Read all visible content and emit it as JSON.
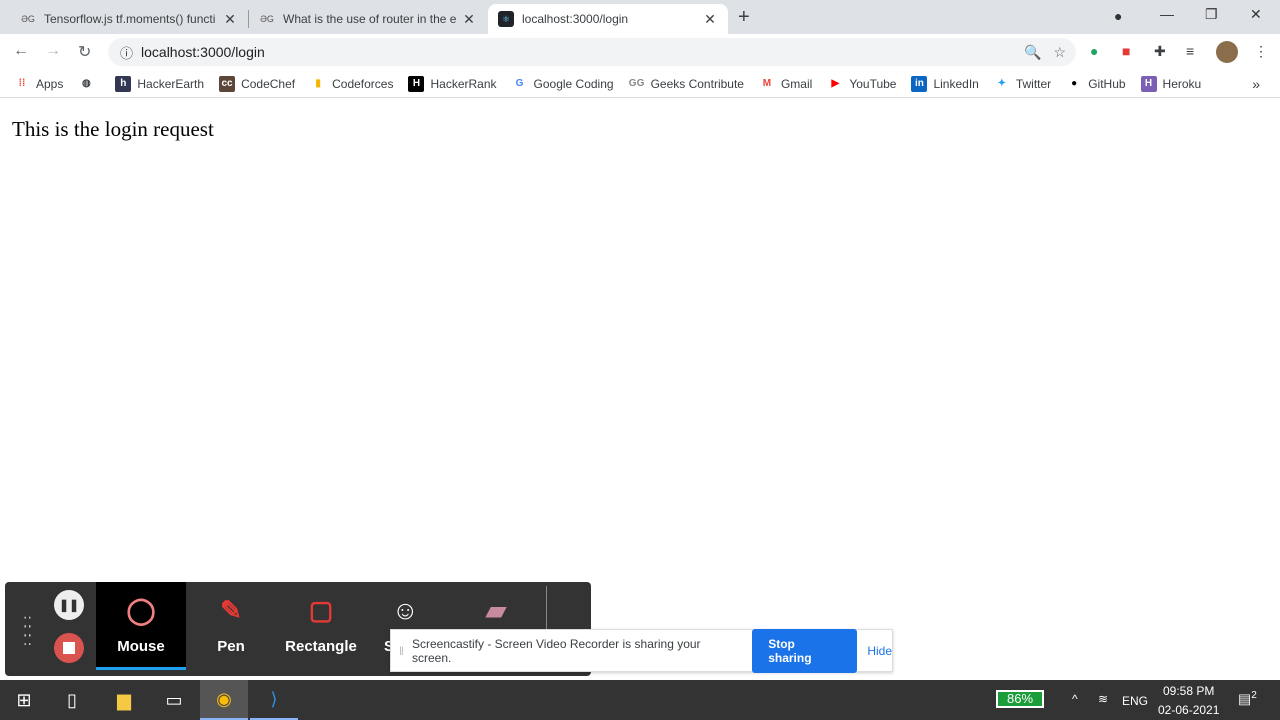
{
  "tabs": [
    {
      "title": "Tensorflow.js tf.moments() functi",
      "favicon": "GG"
    },
    {
      "title": "What is the use of router in the e",
      "favicon": "GG"
    },
    {
      "title": "localhost:3000/login",
      "favicon": "react"
    }
  ],
  "address": {
    "url": "localhost:3000/login"
  },
  "bookmarks": [
    {
      "label": "Apps",
      "icon": "apps-grid",
      "color": "#ea4335"
    },
    {
      "label": "",
      "icon": "globe"
    },
    {
      "label": "HackerEarth",
      "icon": "h",
      "color": "#323754"
    },
    {
      "label": "CodeChef",
      "icon": "cc",
      "color": "#5b4638"
    },
    {
      "label": "Codeforces",
      "icon": "bars",
      "color": "#f4b400"
    },
    {
      "label": "HackerRank",
      "icon": "H",
      "color": "#000000"
    },
    {
      "label": "Google Coding",
      "icon": "G",
      "color": "#4285f4"
    },
    {
      "label": "Geeks Contribute",
      "icon": "GG",
      "color": "#888888"
    },
    {
      "label": "Gmail",
      "icon": "M",
      "color": "#ea4335"
    },
    {
      "label": "YouTube",
      "icon": "play",
      "color": "#ff0000"
    },
    {
      "label": "LinkedIn",
      "icon": "in",
      "color": "#0a66c2"
    },
    {
      "label": "Twitter",
      "icon": "bird",
      "color": "#1da1f2"
    },
    {
      "label": "GitHub",
      "icon": "octocat",
      "color": "#000000"
    },
    {
      "label": "Heroku",
      "icon": "H",
      "color": "#7a5fb5"
    }
  ],
  "page": {
    "text": "This is the login request"
  },
  "screencastify": {
    "tools": [
      {
        "label": "Mouse",
        "icon": "mouse-cursor"
      },
      {
        "label": "Pen",
        "icon": "pen"
      },
      {
        "label": "Rectangle",
        "icon": "rectangle"
      },
      {
        "label": "S",
        "icon": "sticker"
      },
      {
        "label": "",
        "icon": "eraser"
      }
    ],
    "banner_text": "Screencastify - Screen Video Recorder is sharing your screen.",
    "stop_label": "Stop sharing",
    "hide_label": "Hide"
  },
  "taskbar": {
    "battery": "86%",
    "battery_level": 0.86,
    "lang": "ENG",
    "time": "09:58 PM",
    "date": "02-06-2021",
    "notifications": "2"
  }
}
